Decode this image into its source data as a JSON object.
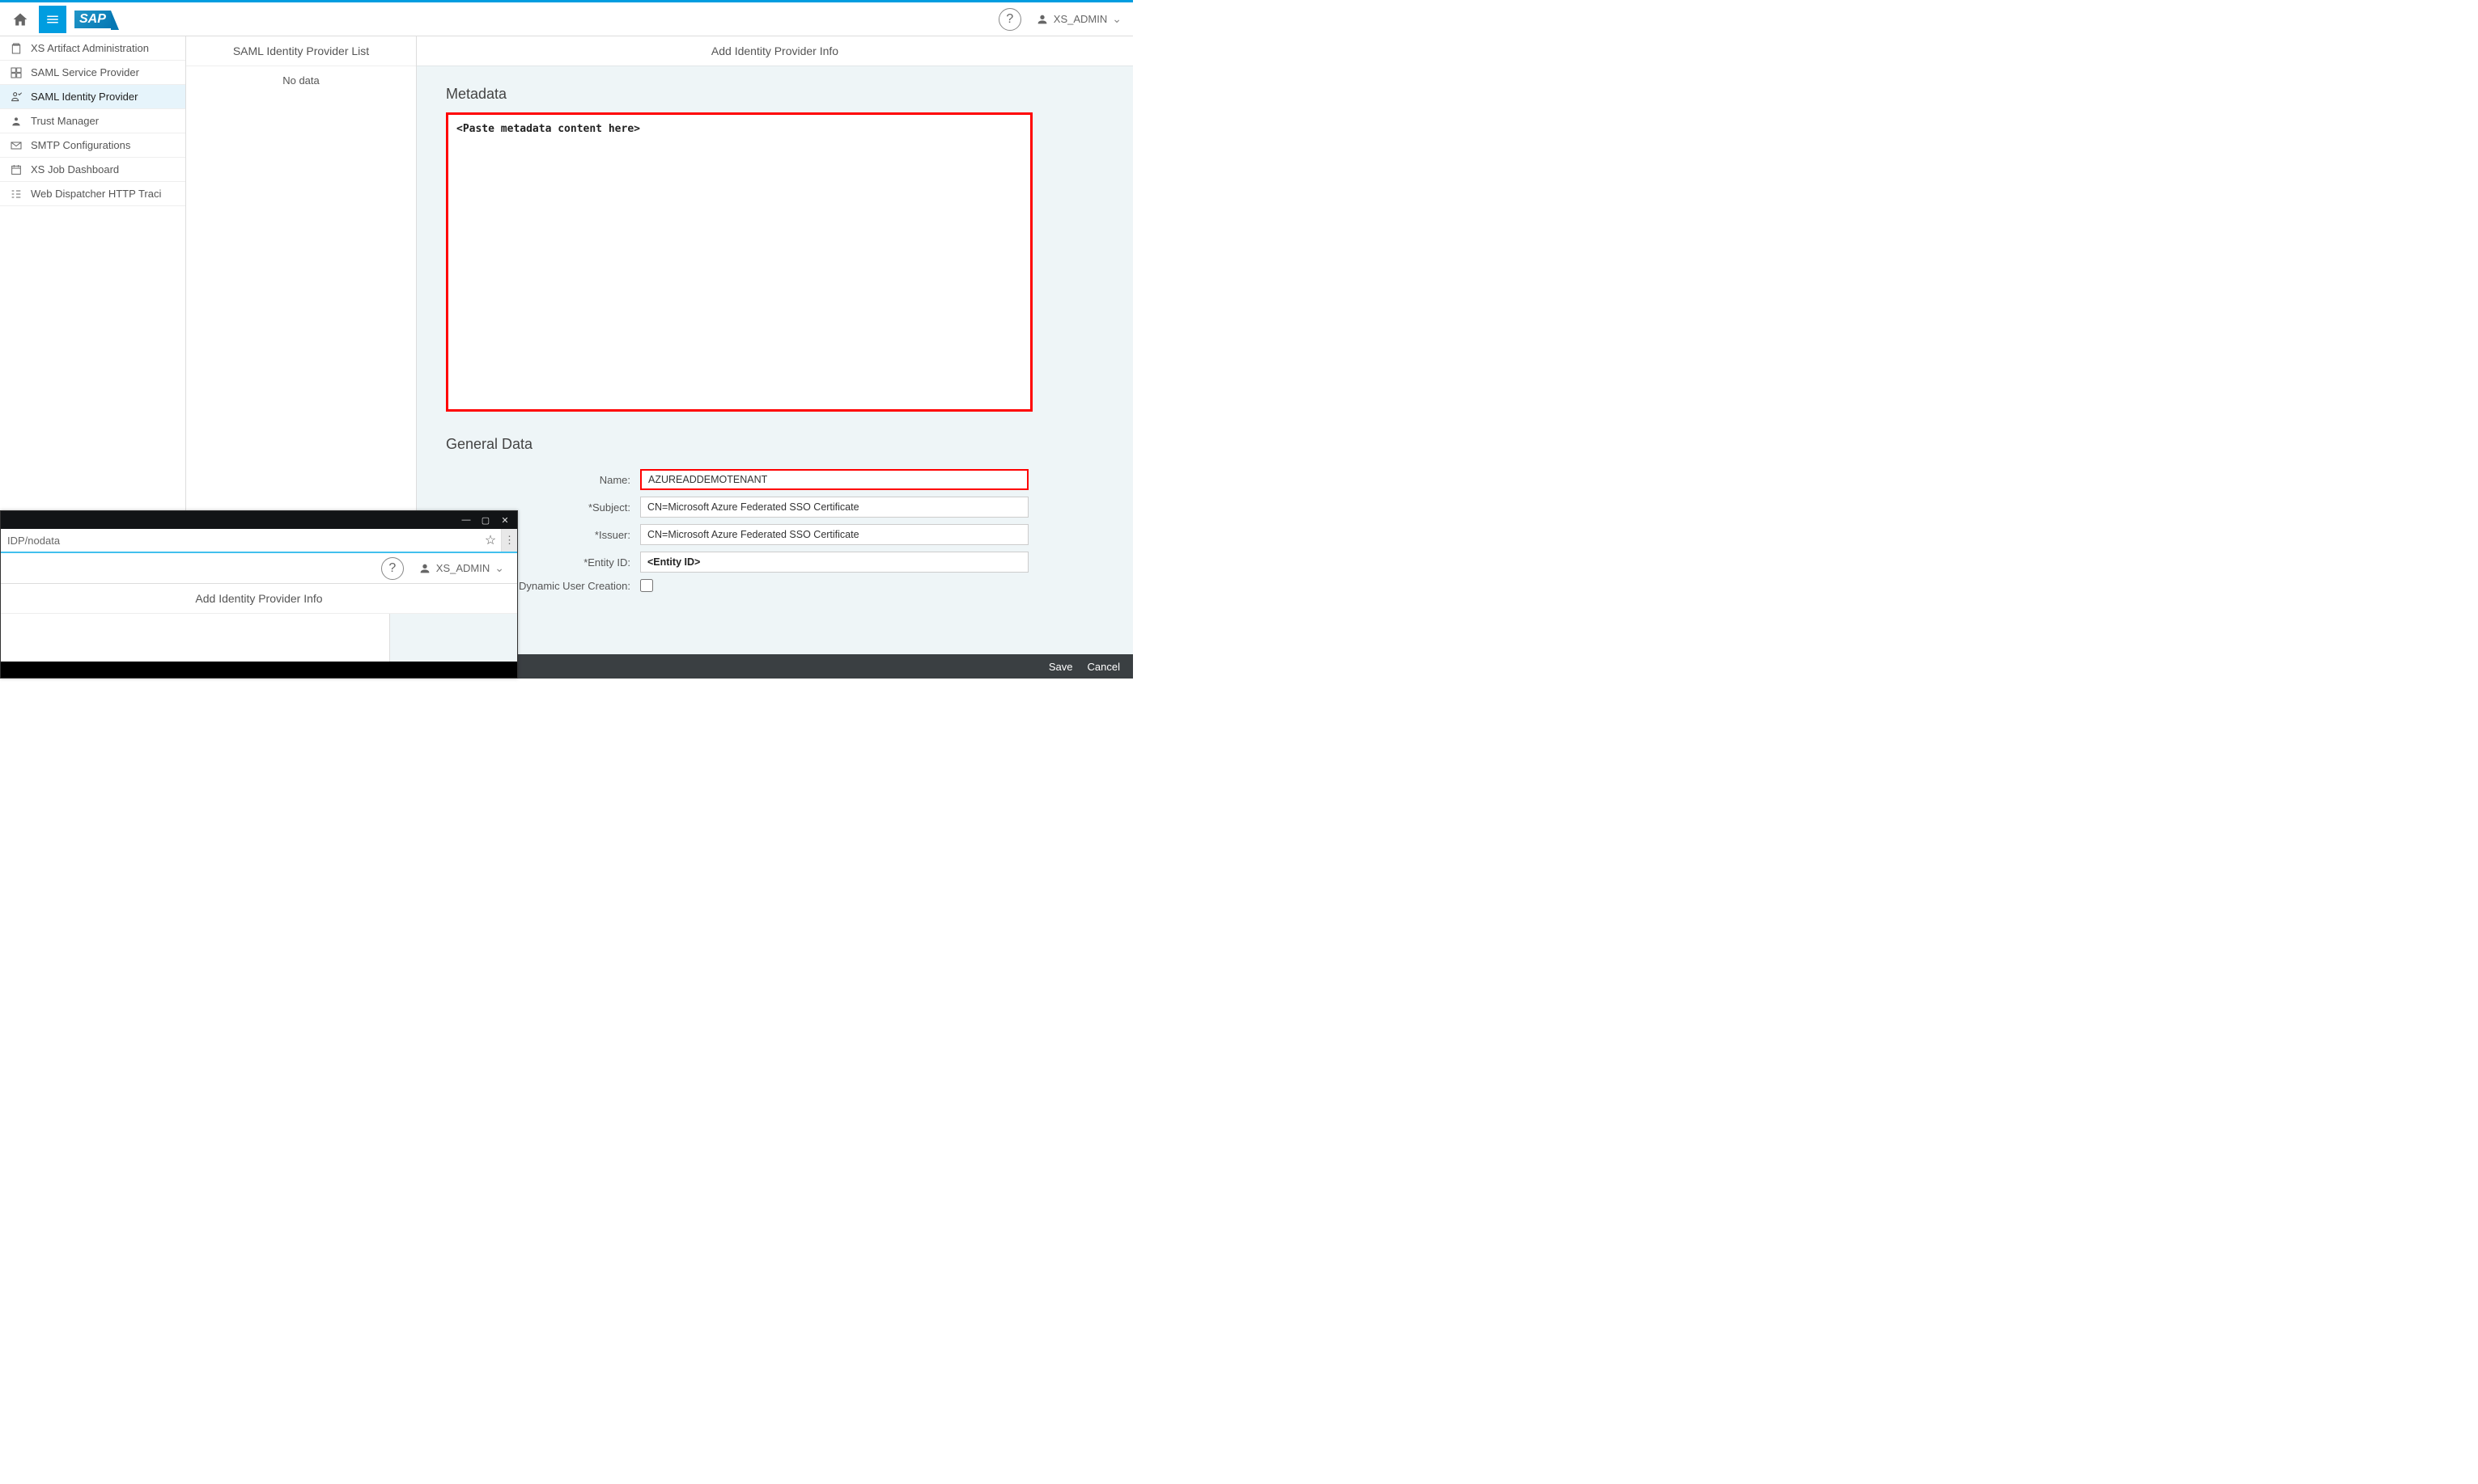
{
  "header": {
    "help_title": "Help",
    "user_name": "XS_ADMIN"
  },
  "sidebar": {
    "items": [
      {
        "label": "XS Artifact Administration"
      },
      {
        "label": "SAML Service Provider"
      },
      {
        "label": "SAML Identity Provider"
      },
      {
        "label": "Trust Manager"
      },
      {
        "label": "SMTP Configurations"
      },
      {
        "label": "XS Job Dashboard"
      },
      {
        "label": "Web Dispatcher HTTP Traci"
      }
    ]
  },
  "middle": {
    "title": "SAML Identity Provider List",
    "empty": "No data"
  },
  "content": {
    "title": "Add Identity Provider Info",
    "metadata_section": "Metadata",
    "metadata_placeholder": "<Paste metadata content here>",
    "general_section": "General Data",
    "fields": {
      "name_label": "Name:",
      "name_value": "AZUREADDEMOTENANT",
      "subject_label": "Subject:",
      "subject_value": "CN=Microsoft Azure Federated SSO Certificate",
      "issuer_label": "Issuer:",
      "issuer_value": "CN=Microsoft Azure Federated SSO Certificate",
      "entity_label": "Entity ID:",
      "entity_value": "<Entity ID>",
      "dynamic_label": "Dynamic User Creation:"
    }
  },
  "footer": {
    "save": "Save",
    "cancel": "Cancel"
  },
  "overlay": {
    "address": "IDP/nodata",
    "user_name": "XS_ADMIN",
    "content_title": "Add Identity Provider Info"
  }
}
